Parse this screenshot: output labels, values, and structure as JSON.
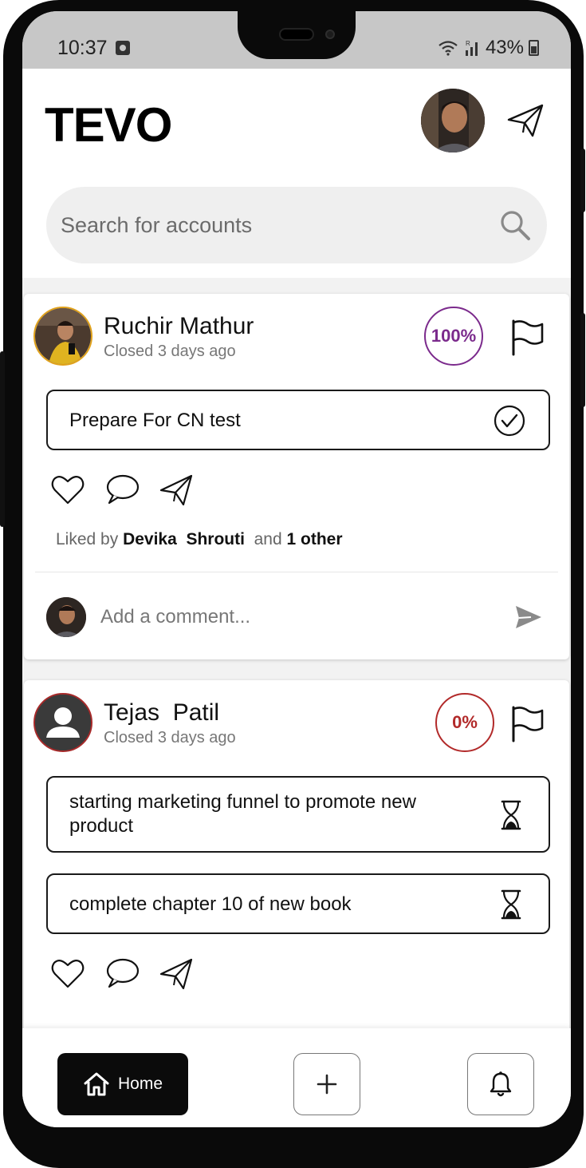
{
  "status_bar": {
    "time": "10:37",
    "battery": "43%"
  },
  "header": {
    "app_title": "TEVO",
    "avatar_icon": "profile-photo",
    "send_icon": "paper-plane-icon"
  },
  "search": {
    "placeholder": "Search for accounts",
    "icon": "search-icon"
  },
  "posts": [
    {
      "user_name": "Ruchir Mathur",
      "subtitle": "Closed 3 days ago",
      "progress_label": "100%",
      "progress_value": 1.0,
      "progress_color": "#7b2a8c",
      "tasks": [
        {
          "text": "Prepare For CN test",
          "status": "completed",
          "icon": "check-circle-icon"
        }
      ],
      "liked_prefix": "Liked by ",
      "liked_users": "Devika  Shrouti",
      "liked_mid": "  and ",
      "liked_others": "1 other",
      "comment_placeholder": "Add a comment..."
    },
    {
      "user_name": "Tejas  Patil",
      "subtitle": "Closed 3 days ago",
      "progress_label": "0%",
      "progress_value": 0.0,
      "progress_color": "#b22a2a",
      "tasks": [
        {
          "text": "starting marketing funnel to promote new product",
          "status": "pending",
          "icon": "hourglass-icon"
        },
        {
          "text": "complete chapter 10 of new book",
          "status": "pending",
          "icon": "hourglass-icon"
        }
      ]
    }
  ],
  "bottom_nav": {
    "home_label": "Home",
    "add_icon": "plus-icon",
    "notifications_icon": "bell-icon"
  },
  "colors": {
    "accent_dark": "#0b0b0b",
    "status_bar_bg": "#c7c7c7"
  }
}
